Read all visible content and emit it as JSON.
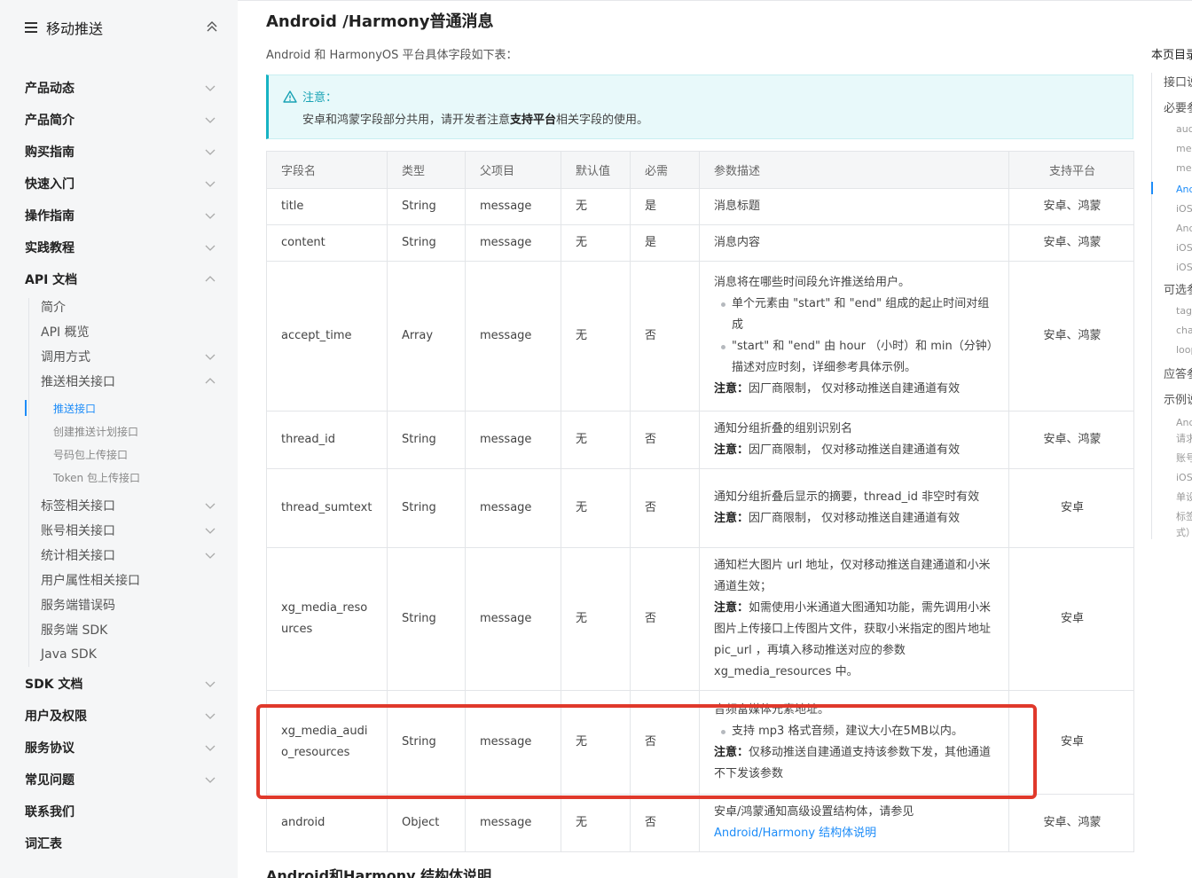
{
  "sidebar": {
    "title": "移动推送",
    "level1": [
      "产品动态",
      "产品简介",
      "购买指南",
      "快速入门",
      "操作指南",
      "实践教程",
      "API 文档",
      "SDK 文档",
      "用户及权限",
      "服务协议",
      "常见问题",
      "联系我们",
      "词汇表"
    ],
    "api_children": [
      "简介",
      "API 概览",
      "调用方式",
      "推送相关接口"
    ],
    "push_children": [
      "推送接口",
      "创建推送计划接口",
      "号码包上传接口",
      "Token 包上传接口"
    ],
    "api_children_after": [
      "标签相关接口",
      "账号相关接口",
      "统计相关接口",
      "用户属性相关接口",
      "服务端错误码",
      "服务端 SDK",
      "Java SDK"
    ]
  },
  "page": {
    "title": "Android /Harmony普通消息",
    "intro": "Android 和 HarmonyOS 平台具体字段如下表：",
    "notice_label": "注意：",
    "notice_pre": "安卓和鸿蒙字段部分共用，请开发者注意",
    "notice_bold": "支持平台",
    "notice_post": "相关字段的使用。",
    "next_section": "Android和Harmony 结构体说明"
  },
  "table": {
    "headers": [
      "字段名",
      "类型",
      "父项目",
      "默认值",
      "必需",
      "参数描述",
      "支持平台"
    ],
    "rows": [
      {
        "name": "title",
        "type": "String",
        "parent": "message",
        "default": "无",
        "required": "是",
        "desc": "消息标题",
        "platform": "安卓、鸿蒙"
      },
      {
        "name": "content",
        "type": "String",
        "parent": "message",
        "default": "无",
        "required": "是",
        "desc": "消息内容",
        "platform": "安卓、鸿蒙"
      },
      {
        "name": "accept_time",
        "type": "Array",
        "parent": "message",
        "default": "无",
        "required": "否",
        "desc": "消息将在哪些时间段允许推送给用户。",
        "bullet1": "单个元素由 \"start\" 和 \"end\" 组成的起止时间对组成",
        "bullet2": "\"start\" 和 \"end\" 由 hour （小时）和 min（分钟）描述对应时刻，详细参考具体示例。",
        "note_label": "注意：",
        "note": "因厂商限制， 仅对移动推送自建通道有效",
        "platform": "安卓、鸿蒙"
      },
      {
        "name": "thread_id",
        "type": "String",
        "parent": "message",
        "default": "无",
        "required": "否",
        "desc": "通知分组折叠的组别识别名",
        "note_label": "注意：",
        "note": "因厂商限制， 仅对移动推送自建通道有效",
        "platform": "安卓、鸿蒙"
      },
      {
        "name": "thread_sumtext",
        "type": "String",
        "parent": "message",
        "default": "无",
        "required": "否",
        "desc": "通知分组折叠后显示的摘要，thread_id 非空时有效",
        "note_label": "注意：",
        "note": "因厂商限制， 仅对移动推送自建通道有效",
        "platform": "安卓"
      },
      {
        "name": "xg_media_resources",
        "type": "String",
        "parent": "message",
        "default": "无",
        "required": "否",
        "desc": "通知栏大图片 url 地址，仅对移动推送自建通道和小米通道生效；",
        "note_label": "注意：",
        "note": "如需使用小米通道大图通知功能，需先调用小米图片上传接口上传图片文件，获取小米指定的图片地址 pic_url ，再填入移动推送对应的参数 xg_media_resources 中。",
        "platform": "安卓"
      },
      {
        "name": "xg_media_audio_resources",
        "type": "String",
        "parent": "message",
        "default": "无",
        "required": "否",
        "desc": "音频富媒体元素地址。",
        "bullet1": "支持 mp3 格式音频，建议大小在5MB以内。",
        "note_label": "注意：",
        "note": "仅移动推送自建通道支持该参数下发，其他通道不下发该参数",
        "platform": "安卓"
      },
      {
        "name": "android",
        "type": "Object",
        "parent": "message",
        "default": "无",
        "required": "否",
        "desc": "安卓/鸿蒙通知高级设置结构体，请参见",
        "link": "Android/Harmony 结构体说明",
        "platform": "安卓、鸿蒙"
      }
    ]
  },
  "toc": {
    "title": "本页目录",
    "items": [
      {
        "level": 1,
        "label": "接口说明"
      },
      {
        "level": 1,
        "label": "必要参数"
      },
      {
        "level": 2,
        "label": "audience_type"
      },
      {
        "level": 2,
        "label": "message_type"
      },
      {
        "level": 2,
        "label": "message"
      },
      {
        "level": 2,
        "label": "Android /Harmony普通消息"
      },
      {
        "level": 2,
        "label": "iOS 普通消息"
      },
      {
        "level": 2,
        "label": "Android 透传消息"
      },
      {
        "level": 2,
        "label": "iOS 静默消息"
      },
      {
        "level": 2,
        "label": "iOS 消息"
      },
      {
        "level": 1,
        "label": "可选参数"
      },
      {
        "level": 2,
        "label": "tag_rules"
      },
      {
        "level": 2,
        "label": "channel_rules"
      },
      {
        "level": 2,
        "label": "loop_param"
      },
      {
        "level": 1,
        "label": "应答参数"
      },
      {
        "level": 1,
        "label": "示例说明"
      },
      {
        "level": 2,
        "label": "Android 全量推送"
      },
      {
        "level": 2,
        "label": "请求示例"
      },
      {
        "level": 2,
        "label": "账号推送"
      },
      {
        "level": 2,
        "label": "iOS 推送"
      },
      {
        "level": 2,
        "label": "单设备推送"
      },
      {
        "level": 2,
        "label": "标签推送（新版格"
      },
      {
        "level": 2,
        "label": "式）"
      }
    ]
  },
  "colors": {
    "accent": "#1d8cf8",
    "notice_bg": "#e8f9fa",
    "notice_text": "#17a2b4",
    "highlight": "#e0392b"
  }
}
